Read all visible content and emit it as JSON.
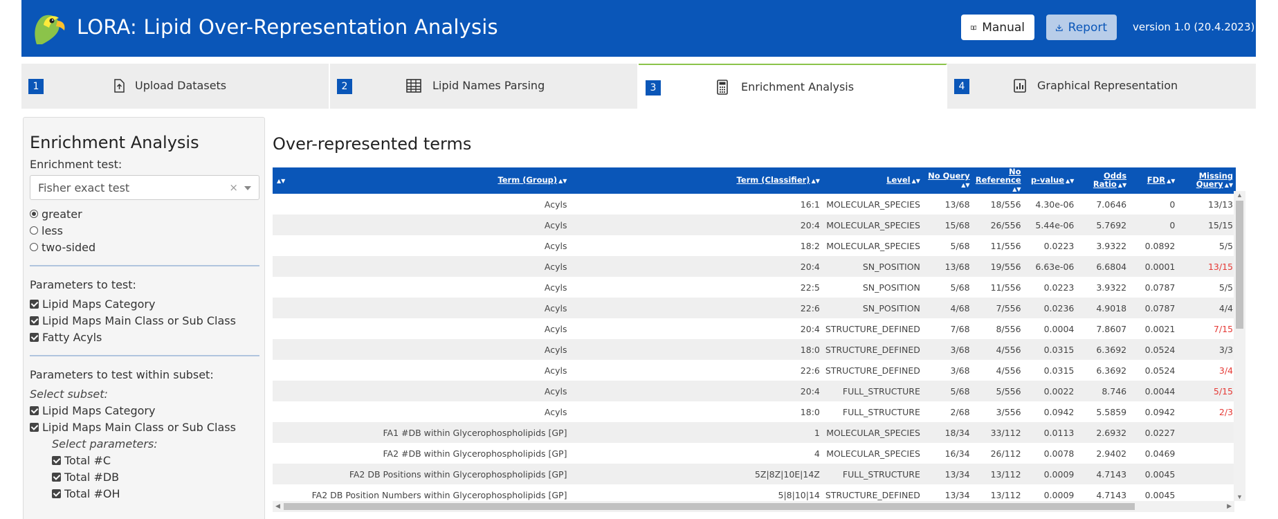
{
  "header": {
    "title": "LORA: Lipid Over-Representation Analysis",
    "manual_label": "Manual",
    "report_label": "Report",
    "version": "version 1.0 (20.4.2023)",
    "bg_color": "#0a56b8"
  },
  "tabs": [
    {
      "num": "1",
      "label": "Upload Datasets",
      "icon": "upload-file-icon"
    },
    {
      "num": "2",
      "label": "Lipid Names Parsing",
      "icon": "table-icon"
    },
    {
      "num": "3",
      "label": "Enrichment Analysis",
      "icon": "calculator-icon",
      "active": true
    },
    {
      "num": "4",
      "label": "Graphical Representation",
      "icon": "bar-chart-icon"
    }
  ],
  "sidebar": {
    "title": "Enrichment Analysis",
    "test_label": "Enrichment test:",
    "test_value": "Fisher exact test",
    "alternatives": [
      "greater",
      "less",
      "two-sided"
    ],
    "selected_alternative": "greater",
    "params_label": "Parameters to test:",
    "params": [
      "Lipid Maps Category",
      "Lipid Maps Main Class or Sub Class",
      "Fatty Acyls"
    ],
    "subset_label": "Parameters to test within subset:",
    "select_subset_label": "Select subset:",
    "subsets": [
      "Lipid Maps Category",
      "Lipid Maps Main Class or Sub Class"
    ],
    "select_params_label": "Select parameters:",
    "sub_params": [
      "Total #C",
      "Total #DB",
      "Total #OH"
    ]
  },
  "main": {
    "title": "Over-represented terms",
    "columns": [
      "Term (Group)",
      "Term (Classifier)",
      "Level",
      "No Query",
      "No Reference",
      "p-value",
      "Odds Ratio",
      "FDR",
      "Missing Query"
    ],
    "rows": [
      [
        "Acyls",
        "16:1",
        "MOLECULAR_SPECIES",
        "13/68",
        "18/556",
        "4.30e-06",
        "7.0646",
        "0",
        "13/13"
      ],
      [
        "Acyls",
        "20:4",
        "MOLECULAR_SPECIES",
        "15/68",
        "26/556",
        "5.44e-06",
        "5.7692",
        "0",
        "15/15"
      ],
      [
        "Acyls",
        "18:2",
        "MOLECULAR_SPECIES",
        "5/68",
        "11/556",
        "0.0223",
        "3.9322",
        "0.0892",
        "5/5"
      ],
      [
        "Acyls",
        "20:4",
        "SN_POSITION",
        "13/68",
        "19/556",
        "6.63e-06",
        "6.6804",
        "0.0001",
        "13/15"
      ],
      [
        "Acyls",
        "22:5",
        "SN_POSITION",
        "5/68",
        "11/556",
        "0.0223",
        "3.9322",
        "0.0787",
        "5/5"
      ],
      [
        "Acyls",
        "22:6",
        "SN_POSITION",
        "4/68",
        "7/556",
        "0.0236",
        "4.9018",
        "0.0787",
        "4/4"
      ],
      [
        "Acyls",
        "20:4",
        "STRUCTURE_DEFINED",
        "7/68",
        "8/556",
        "0.0004",
        "7.8607",
        "0.0021",
        "7/15"
      ],
      [
        "Acyls",
        "18:0",
        "STRUCTURE_DEFINED",
        "3/68",
        "4/556",
        "0.0315",
        "6.3692",
        "0.0524",
        "3/3"
      ],
      [
        "Acyls",
        "22:6",
        "STRUCTURE_DEFINED",
        "3/68",
        "4/556",
        "0.0315",
        "6.3692",
        "0.0524",
        "3/4"
      ],
      [
        "Acyls",
        "20:4",
        "FULL_STRUCTURE",
        "5/68",
        "5/556",
        "0.0022",
        "8.746",
        "0.0044",
        "5/15"
      ],
      [
        "Acyls",
        "18:0",
        "FULL_STRUCTURE",
        "2/68",
        "3/556",
        "0.0942",
        "5.5859",
        "0.0942",
        "2/3"
      ],
      [
        "FA1 #DB within Glycerophospholipids [GP]",
        "1",
        "MOLECULAR_SPECIES",
        "18/34",
        "33/112",
        "0.0113",
        "2.6932",
        "0.0227",
        ""
      ],
      [
        "FA2 #DB within Glycerophospholipids [GP]",
        "4",
        "MOLECULAR_SPECIES",
        "16/34",
        "26/112",
        "0.0078",
        "2.9402",
        "0.0469",
        ""
      ],
      [
        "FA2 DB Positions within Glycerophospholipids [GP]",
        "5Z|8Z|10E|14Z",
        "FULL_STRUCTURE",
        "13/34",
        "13/112",
        "0.0009",
        "4.7143",
        "0.0045",
        ""
      ],
      [
        "FA2 DB Position Numbers within Glycerophospholipids [GP]",
        "5|8|10|14",
        "STRUCTURE_DEFINED",
        "13/34",
        "13/112",
        "0.0009",
        "4.7143",
        "0.0045",
        ""
      ]
    ],
    "red_missing": [
      3,
      6,
      8,
      9,
      10
    ]
  }
}
